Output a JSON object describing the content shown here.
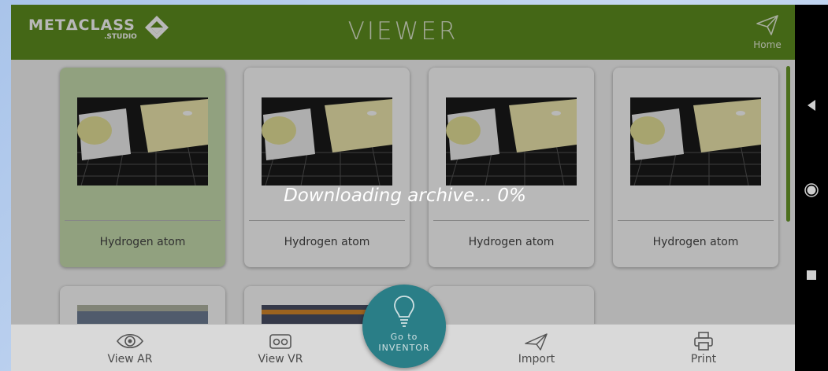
{
  "header": {
    "logo_text": "METΔCLASS",
    "logo_sub": ".STUDIO",
    "title": "VIEWER",
    "home_label": "Home"
  },
  "cards": [
    {
      "label": "Hydrogen atom",
      "selected": true
    },
    {
      "label": "Hydrogen atom",
      "selected": false
    },
    {
      "label": "Hydrogen atom",
      "selected": false
    },
    {
      "label": "Hydrogen atom",
      "selected": false
    }
  ],
  "overlay": {
    "progress_text": "Downloading archive... 0%",
    "progress_value": 0
  },
  "bottom_nav": {
    "view_ar": "View AR",
    "view_vr": "View VR",
    "fab_line1": "Go to",
    "fab_line2": "INVENTOR",
    "import": "Import",
    "print": "Print"
  },
  "icons": {
    "home": "paper-plane-icon",
    "view_ar": "eye-icon",
    "view_vr": "vr-headset-icon",
    "fab": "lightbulb-icon",
    "import": "paper-plane-outline-icon",
    "print": "printer-icon",
    "android_back": "triangle-back-icon",
    "android_home": "circle-home-icon",
    "android_recents": "square-recents-icon"
  },
  "colors": {
    "header_green": "#5f8f1f",
    "selected_card": "#c9dfb0",
    "fab_teal": "#2a7e87"
  }
}
